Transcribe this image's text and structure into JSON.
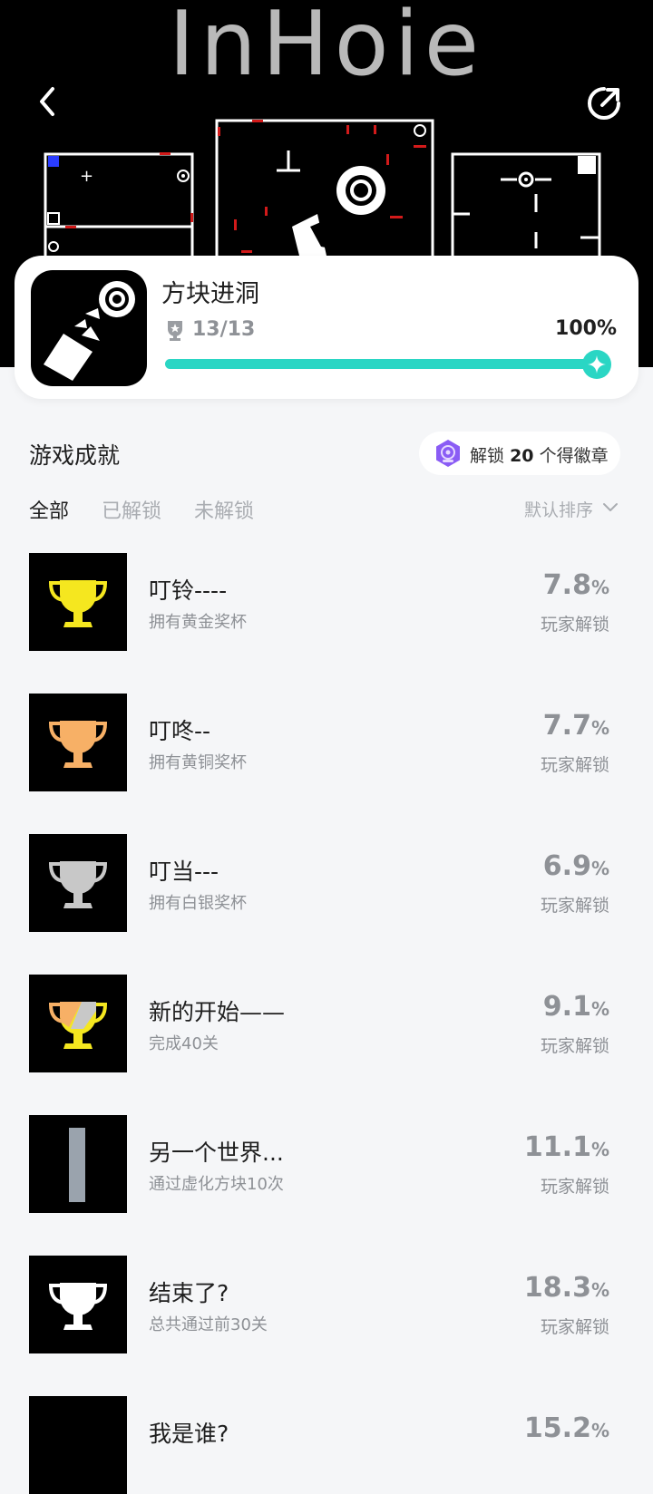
{
  "hero": {
    "logo": "InHoie"
  },
  "game": {
    "name": "方块进洞",
    "achievement_count": "13/13",
    "progress_percent": "100%",
    "progress": 1.0,
    "accent_color": "#2ad6c4"
  },
  "section": {
    "title": "游戏成就",
    "badge_prefix": "解锁",
    "badge_number": "20",
    "badge_suffix": "个得徽章"
  },
  "tabs": [
    "全部",
    "已解锁",
    "未解锁"
  ],
  "sort_label": "默认排序",
  "achievements": [
    {
      "title": "叮铃----",
      "desc": "拥有黄金奖杯",
      "pct": "7.8",
      "unit": "%",
      "sub": "玩家解锁",
      "icon": "gold-trophy-icon"
    },
    {
      "title": "叮咚--",
      "desc": "拥有黄铜奖杯",
      "pct": "7.7",
      "unit": "%",
      "sub": "玩家解锁",
      "icon": "bronze-trophy-icon"
    },
    {
      "title": "叮当---",
      "desc": "拥有白银奖杯",
      "pct": "6.9",
      "unit": "%",
      "sub": "玩家解锁",
      "icon": "silver-trophy-icon"
    },
    {
      "title": "新的开始——",
      "desc": "完成40关",
      "pct": "9.1",
      "unit": "%",
      "sub": "玩家解锁",
      "icon": "mixed-trophy-icon"
    },
    {
      "title": "另一个世界...",
      "desc": "通过虚化方块10次",
      "pct": "11.1",
      "unit": "%",
      "sub": "玩家解锁",
      "icon": "gray-bar-icon"
    },
    {
      "title": "结束了?",
      "desc": "总共通过前30关",
      "pct": "18.3",
      "unit": "%",
      "sub": "玩家解锁",
      "icon": "white-trophy-icon"
    },
    {
      "title": "我是谁?",
      "desc": "",
      "pct": "15.2",
      "unit": "%",
      "sub": "",
      "icon": ""
    }
  ]
}
